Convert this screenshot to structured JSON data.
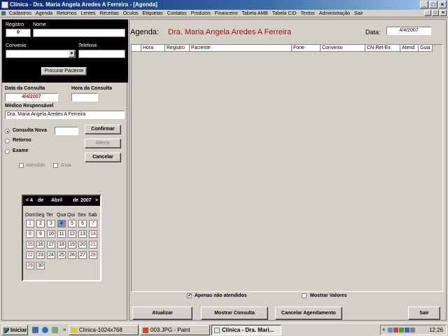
{
  "window": {
    "title": "Clínica - Dra. Maria Angela Aredes A Ferreira - [Agenda]"
  },
  "menu": [
    "Cadastros",
    "Agenda",
    "Retornos",
    "Lentes",
    "Receitas",
    "Óculos",
    "Etiquetas",
    "Contatos",
    "Produtos",
    "Financeiro",
    "Tabela AMB",
    "Tabela CID",
    "Textos",
    "Administração",
    "Sair"
  ],
  "search": {
    "registro_label": "Registro",
    "registro_value": "0",
    "nome_label": "Nome",
    "nome_value": "",
    "convenio_label": "Convenio",
    "convenio_value": "",
    "telefone_label": "Telefone",
    "telefone_value": "",
    "search_button": "Procurar Paciente"
  },
  "consulta": {
    "data_label": "Data da Consulta",
    "data_value": "4/4/2007",
    "hora_label": "Hora da Consulta",
    "hora_value": "",
    "medico_label": "Médico Responsável",
    "medico_value": "Dra. Maria Angela Aredes A Ferreira",
    "tipo_options": [
      "Consulta Nova",
      "Retorno",
      "Exame"
    ],
    "tipo_selected": "Consulta Nova",
    "tipo_extra_value": "",
    "atendido_label": "Atendido",
    "guia_label": "Guia",
    "confirmar_button": "Confirmar",
    "alterar_button": "Alterar",
    "cancelar_button": "Cancelar"
  },
  "calendar": {
    "day": "4",
    "de1": "de",
    "month": "Abril",
    "de2": "de",
    "year": "2007",
    "prev": "<",
    "next": ">",
    "weekdays": [
      "Dom",
      "Seg",
      "Ter",
      "Qua",
      "Qui",
      "Sex",
      "Sab"
    ],
    "days": [
      "1",
      "2",
      "3",
      "4",
      "5",
      "6",
      "7",
      "8",
      "9",
      "10",
      "11",
      "12",
      "13",
      "14",
      "15",
      "16",
      "17",
      "18",
      "19",
      "20",
      "21",
      "22",
      "23",
      "24",
      "25",
      "26",
      "27",
      "28",
      "29",
      "30"
    ],
    "selected_day": "4"
  },
  "agenda": {
    "label": "Agenda:",
    "doctor": "Dra. Maria Angela Aredes A Ferreira",
    "date_label": "Data:",
    "date_value": "4/4/2007",
    "columns": [
      "",
      "Hora",
      "Registro",
      "Paciente",
      "Fone",
      "Convenio",
      "CN-Ret-Ex",
      "Atend",
      "Guia"
    ],
    "only_unattended_label": "Apenas não atendidos",
    "only_unattended_checked": true,
    "show_values_label": "Mostrar Valores",
    "show_values_checked": false,
    "atualizar_button": "Atualizar",
    "mostrar_button": "Mostrar Consulta",
    "cancelar_agendamento_button": "Cancelar Agendamento",
    "sair_button": "Sair"
  },
  "taskbar": {
    "start": "Iniciar",
    "tasks": [
      "Clinica-1024x768",
      "003.JPG - Paint",
      "Clínica - Dra. Mari..."
    ],
    "clock": "12:26"
  },
  "colors": {
    "title_blue": "#0a246a",
    "doctor_red": "#9a1010",
    "calendar_selected": "#7b8fc8"
  }
}
